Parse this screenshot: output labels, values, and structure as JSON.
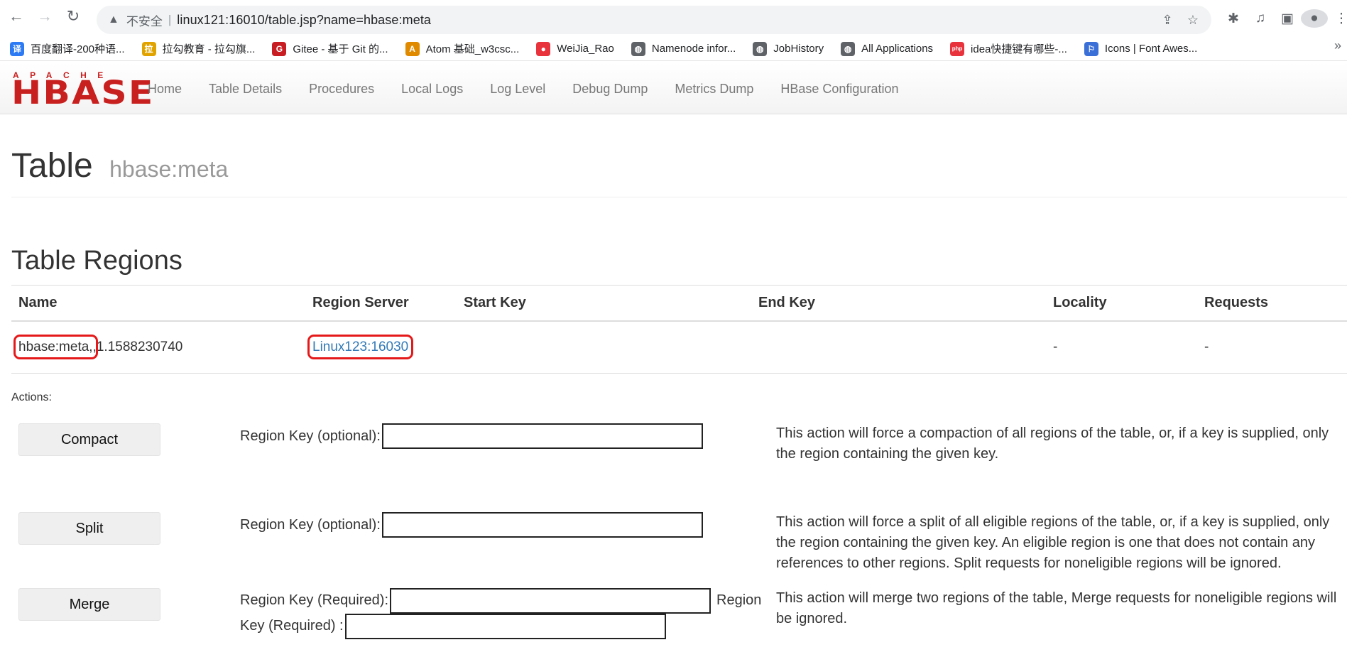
{
  "browser": {
    "back_icon": "←",
    "forward_icon": "→",
    "reload_icon": "↻",
    "security_warning": "不安全",
    "url": "linux121:16010/table.jsp?name=hbase:meta",
    "bookmarks": [
      {
        "label": "百度翻译-200种语...",
        "icon": "译",
        "color": "#2d7bf4"
      },
      {
        "label": "拉勾教育 - 拉勾旗...",
        "icon": "拉",
        "color": "#e0a300"
      },
      {
        "label": "Gitee - 基于 Git 的...",
        "icon": "G",
        "color": "#c71d23"
      },
      {
        "label": "Atom 基础_w3csc...",
        "icon": "A",
        "color": "#e08a00"
      },
      {
        "label": "WeiJia_Rao",
        "icon": "●",
        "color": "#e8323c"
      },
      {
        "label": "Namenode infor...",
        "icon": "◍",
        "color": "#5f6368"
      },
      {
        "label": "JobHistory",
        "icon": "◍",
        "color": "#5f6368"
      },
      {
        "label": "All Applications",
        "icon": "◍",
        "color": "#5f6368"
      },
      {
        "label": "idea快捷键有哪些-...",
        "icon": "php",
        "color": "#e8323c"
      },
      {
        "label": "Icons | Font Awes...",
        "icon": "⚐",
        "color": "#3b6fd8"
      }
    ]
  },
  "hbase": {
    "logo_top": "APACHE",
    "logo_main": "HBASE",
    "nav": [
      "Home",
      "Table Details",
      "Procedures",
      "Local Logs",
      "Log Level",
      "Debug Dump",
      "Metrics Dump",
      "HBase Configuration"
    ]
  },
  "page": {
    "title": "Table",
    "subtitle": "hbase:meta",
    "section": "Table Regions",
    "columns": [
      "Name",
      "Region Server",
      "Start Key",
      "End Key",
      "Locality",
      "Requests"
    ],
    "row": {
      "name_highlight": "hbase:meta,",
      "name_rest": ",1.1588230740",
      "server": "Linux123:16030",
      "start_key": "",
      "end_key": "",
      "locality": "-",
      "requests": "-"
    },
    "actions_label": "Actions:",
    "compact": {
      "button": "Compact",
      "label": "Region Key (optional):",
      "description": "This action will force a compaction of all regions of the table, or, if a key is supplied, only the region containing the given key."
    },
    "split": {
      "button": "Split",
      "label": "Region Key (optional):",
      "description": "This action will force a split of all eligible regions of the table, or, if a key is supplied, only the region containing the given key. An eligible region is one that does not contain any references to other regions. Split requests for noneligible regions will be ignored."
    },
    "merge": {
      "button": "Merge",
      "label1": "Region Key (Required):",
      "label2_part1": "Region",
      "label2_part2": "Key (Required) :",
      "description": "This action will merge two regions of the table, Merge requests for noneligible regions will be ignored."
    }
  }
}
